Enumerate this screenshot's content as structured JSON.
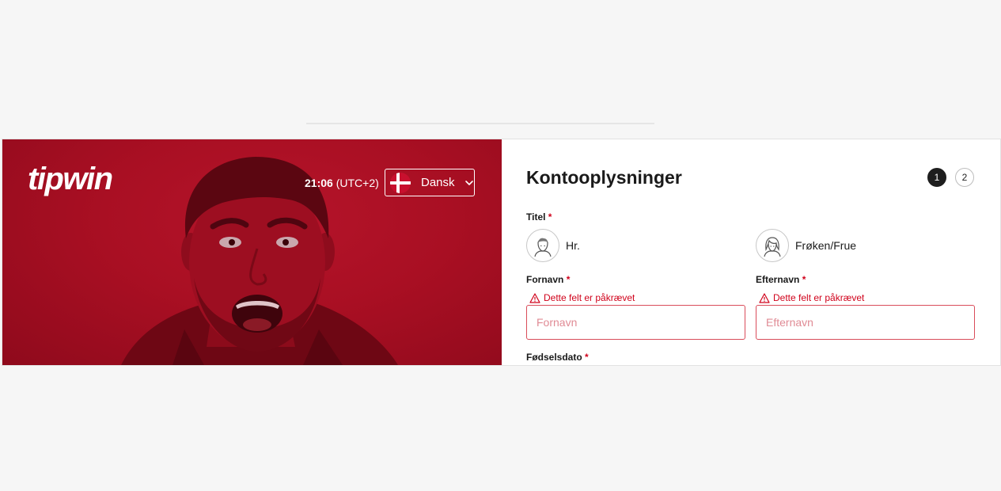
{
  "brand": {
    "logo_text": "tipwin"
  },
  "header": {
    "time": "21:06",
    "timezone": "(UTC+2)",
    "language": "Dansk"
  },
  "form": {
    "title": "Kontooplysninger",
    "steps": [
      "1",
      "2"
    ],
    "active_step": 1,
    "required_marker": "*",
    "title_label": "Titel",
    "title_options": [
      "Hr.",
      "Frøken/Frue"
    ],
    "firstname": {
      "label": "Fornavn",
      "error": "Dette felt er påkrævet",
      "placeholder": "Fornavn",
      "value": ""
    },
    "lastname": {
      "label": "Efternavn",
      "error": "Dette felt er påkrævet",
      "placeholder": "Efternavn",
      "value": ""
    },
    "birthdate_label": "Fødselsdato"
  },
  "icons": {
    "flag": "denmark-flag-icon",
    "chevron": "chevron-down-icon",
    "male_avatar": "male-avatar-icon",
    "female_avatar": "female-avatar-icon",
    "warning": "warning-icon"
  },
  "colors": {
    "brand_red": "#a90f23",
    "error_red": "#d0021b",
    "step_active": "#1e1e1e"
  }
}
